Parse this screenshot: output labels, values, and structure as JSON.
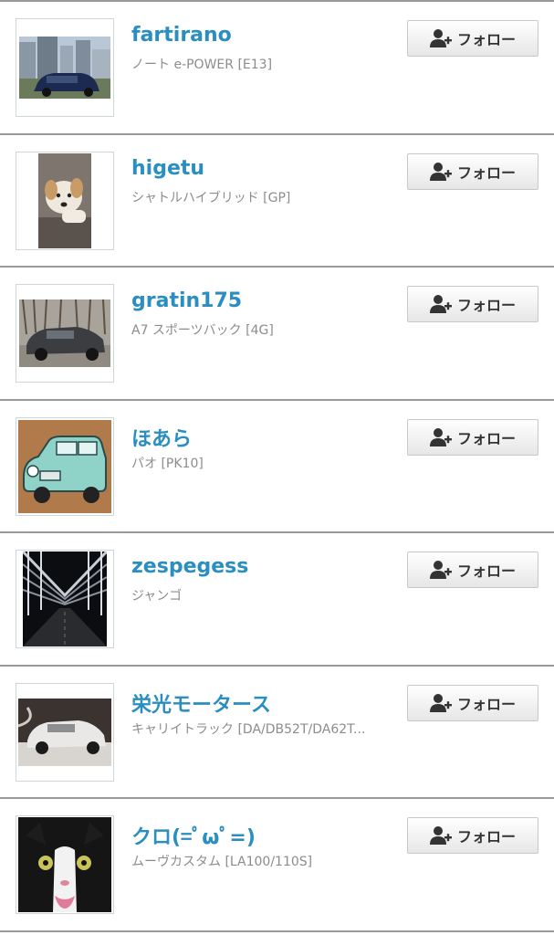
{
  "users": [
    {
      "name": "fartirano",
      "car": "ノート e-POWER [E13]",
      "follow_label": "フォロー",
      "thumb": "car-city-icon"
    },
    {
      "name": "higetu",
      "car": "シャトルハイブリッド [GP]",
      "follow_label": "フォロー",
      "thumb": "dog-photo"
    },
    {
      "name": "gratin175",
      "car": "A7 スポーツバック [4G]",
      "follow_label": "フォロー",
      "thumb": "sedan-photo"
    },
    {
      "name": "ほあら",
      "car": "パオ [PK10]",
      "follow_label": "フォロー",
      "thumb": "pao-illustration"
    },
    {
      "name": "zespegess",
      "car": "ジャンゴ",
      "follow_label": "フォロー",
      "thumb": "bridge-photo"
    },
    {
      "name": "栄光モータース",
      "car": "キャリイトラック [DA/DB52T/DA62T...",
      "follow_label": "フォロー",
      "thumb": "snow-car-photo"
    },
    {
      "name": "クロ(=ﾟωﾟ=)",
      "car": "ムーヴカスタム [LA100/110S]",
      "follow_label": "フォロー",
      "thumb": "cat-photo"
    }
  ],
  "colors": {
    "name": "#2a8fc0",
    "subtext": "#8c8c8c",
    "divider": "#9a9a9a"
  }
}
